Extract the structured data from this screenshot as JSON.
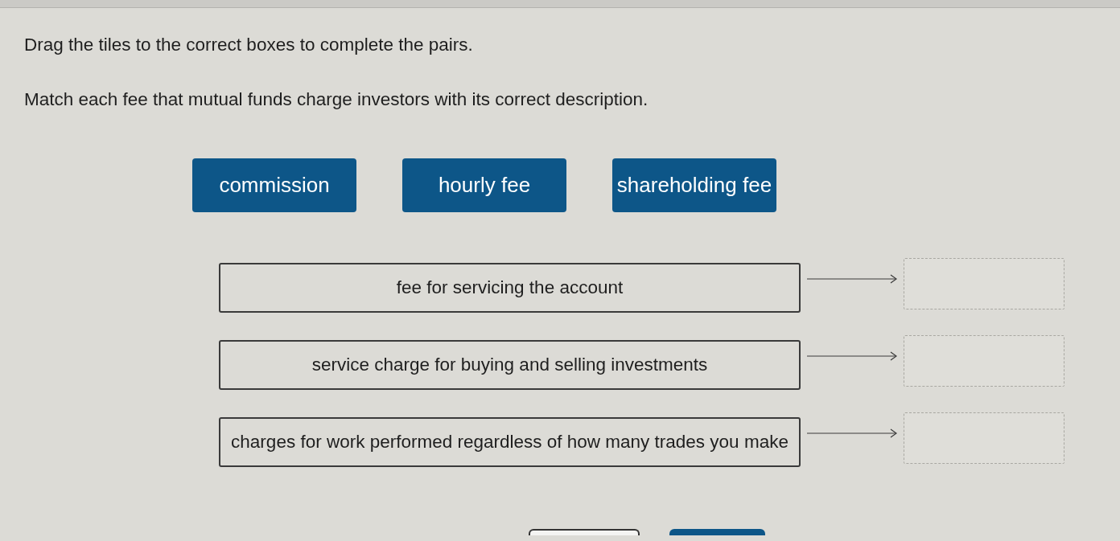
{
  "instructions": [
    "Drag the tiles to the correct boxes to complete the pairs.",
    "Match each fee that mutual funds charge investors with its correct description."
  ],
  "tiles": [
    {
      "label": "commission"
    },
    {
      "label": "hourly fee"
    },
    {
      "label": "shareholding fee"
    }
  ],
  "pairs": [
    {
      "description": "fee for servicing the account"
    },
    {
      "description": "service charge for buying and selling investments"
    },
    {
      "description": "charges for work performed regardless of how many trades you make"
    }
  ],
  "bottom_buttons": [
    {
      "kind": "outlined"
    },
    {
      "kind": "filled"
    }
  ]
}
